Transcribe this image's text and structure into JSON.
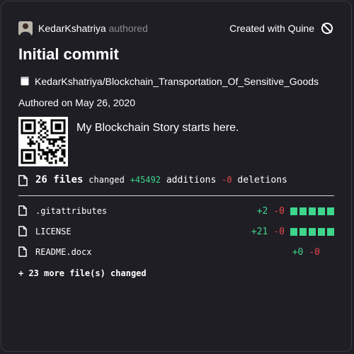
{
  "header": {
    "author": "KedarKshatriya",
    "authored_label": "authored",
    "created_with": "Created with Quine",
    "quine_icon": "quine-logo-icon"
  },
  "commit": {
    "title": "Initial commit",
    "repo": "KedarKshatriya/Blockchain_Transportation_Of_Sensitive_Goods",
    "authored_on": "Authored on May 26, 2020",
    "message": "My Blockchain Story starts here."
  },
  "summary": {
    "files_count": "26 files",
    "changed_label": "changed",
    "additions": "+45492",
    "additions_label": "additions",
    "deletions": "-0",
    "deletions_label": "deletions"
  },
  "files": [
    {
      "name": ".gitattributes",
      "added": "+2",
      "removed": "-0",
      "bars": 5
    },
    {
      "name": "LICENSE",
      "added": "+21",
      "removed": "-0",
      "bars": 5
    },
    {
      "name": "README.docx",
      "added": "+0",
      "removed": "-0",
      "bars": 0
    }
  ],
  "more_files": "+ 23 more file(s) changed",
  "colors": {
    "background": "#1f1e24",
    "addition": "#3dd68c",
    "deletion": "#e5484d",
    "muted": "#8b8a91"
  }
}
